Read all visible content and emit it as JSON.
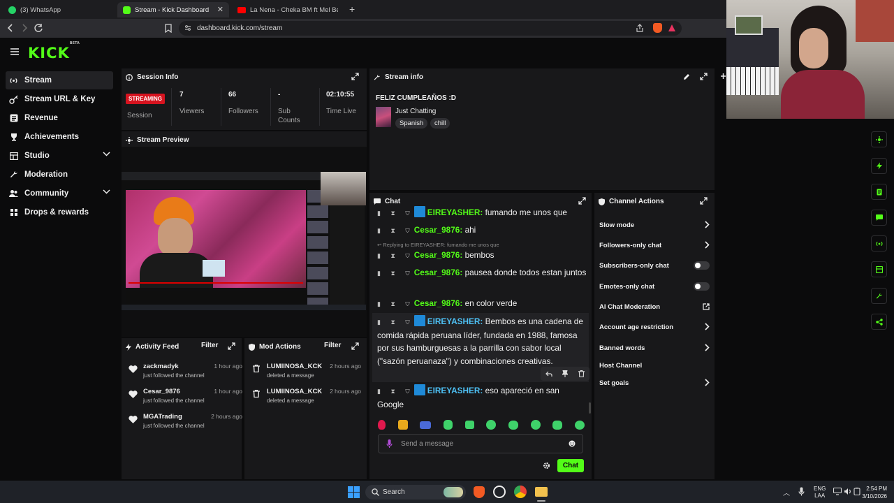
{
  "browser": {
    "tabs": [
      {
        "title": "(3) WhatsApp"
      },
      {
        "title": "Stream - Kick Dashboard"
      },
      {
        "title": "La Nena - Cheka BM ft Mel Bebesuki"
      }
    ],
    "url": "dashboard.kick.com/stream"
  },
  "brand": {
    "logo": "KICK",
    "beta": "BETA",
    "accent": "#53fc18"
  },
  "sidebar": {
    "items": [
      {
        "label": "Stream",
        "icon": "broadcast-icon"
      },
      {
        "label": "Stream URL & Key",
        "icon": "key-icon"
      },
      {
        "label": "Revenue",
        "icon": "revenue-icon"
      },
      {
        "label": "Achievements",
        "icon": "trophy-icon"
      },
      {
        "label": "Studio",
        "icon": "studio-icon"
      },
      {
        "label": "Moderation",
        "icon": "wrench-icon"
      },
      {
        "label": "Community",
        "icon": "community-icon"
      },
      {
        "label": "Drops & rewards",
        "icon": "gift-icon"
      }
    ]
  },
  "session": {
    "title": "Session Info",
    "badge": "STREAMING",
    "badge_color": "#d6131f",
    "session_label": "Session",
    "viewers": "7",
    "viewers_label": "Viewers",
    "followers": "66",
    "followers_label": "Followers",
    "subs": "-",
    "subs_label_1": "Sub",
    "subs_label_2": "Counts",
    "time": "02:10:55",
    "time_label": "Time Live"
  },
  "stream_info": {
    "title": "Stream info",
    "stream_title": "FELIZ CUMPLEAÑOS :D",
    "category": "Just Chatting",
    "tags": [
      "Spanish",
      "chill"
    ]
  },
  "preview": {
    "title": "Stream Preview"
  },
  "activity": {
    "title": "Activity Feed",
    "filter": "Filter",
    "items": [
      {
        "name": "zackmadyk",
        "sub": "just followed the channel",
        "time": "1 hour ago"
      },
      {
        "name": "Cesar_9876",
        "sub": "just followed the channel",
        "time": "1 hour ago"
      },
      {
        "name": "MGATrading",
        "sub": "just followed the channel",
        "time": "2 hours ago"
      }
    ]
  },
  "mod_actions": {
    "title": "Mod Actions",
    "filter": "Filter",
    "items": [
      {
        "name": "LUMIINOSA_KCK",
        "sub": "deleted a message",
        "time": "2 hours ago"
      },
      {
        "name": "LUMIINOSA_KCK",
        "sub": "deleted a message",
        "time": "2 hours ago"
      }
    ]
  },
  "chat": {
    "title": "Chat",
    "reply_hint": "Replying to EIREYASHER: fumando me unos que",
    "messages": [
      {
        "user": "EIREYASHER:",
        "text": "fumando me unos que"
      },
      {
        "user": "Cesar_9876:",
        "text": "ahi"
      },
      {
        "user": "Cesar_9876:",
        "text": "bembos"
      },
      {
        "user": "Cesar_9876:",
        "text": "pausea donde todos estan juntos"
      },
      {
        "user": "Cesar_9876:",
        "text": "en color verde"
      },
      {
        "user": "EIREYASHER:",
        "text": "Bembos es una cadena de comida rápida peruana líder, fundada en 1988, famosa por sus hamburguesas a la parrilla con sabor local (\"sazón peruanaza\") y combinaciones creativas."
      },
      {
        "user": "EIREYASHER:",
        "text": "eso apareció en san Google"
      }
    ],
    "placeholder": "Send a message",
    "send": "Chat"
  },
  "channel_actions": {
    "title": "Channel Actions",
    "items": [
      {
        "label": "Slow mode",
        "control": "arrow"
      },
      {
        "label": "Followers-only chat",
        "control": "arrow"
      },
      {
        "label": "Subscribers-only chat",
        "control": "toggle",
        "on": false
      },
      {
        "label": "Emotes-only chat",
        "control": "toggle",
        "on": false
      },
      {
        "label": "AI Chat Moderation",
        "control": "external"
      },
      {
        "label": "Account age restriction",
        "control": "arrow"
      },
      {
        "label": "Banned words",
        "control": "arrow"
      },
      {
        "label": "Host Channel",
        "control": "none"
      },
      {
        "label": "Set goals",
        "control": "arrow"
      }
    ]
  },
  "taskbar": {
    "search": "Search",
    "lang_1": "ENG",
    "lang_2": "LAA",
    "time": "2:54 PM",
    "date": "3/10/2026"
  }
}
